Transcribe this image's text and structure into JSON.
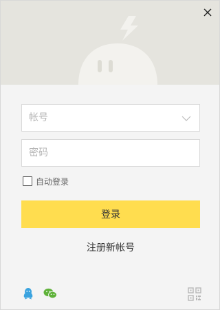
{
  "window": {
    "close_icon": "close-icon"
  },
  "login_form": {
    "account_placeholder": "帐号",
    "password_placeholder": "密码",
    "auto_login_label": "自动登录",
    "login_button_label": "登录",
    "register_link_label": "注册新帐号"
  },
  "footer": {
    "social_icons": [
      "qq-icon",
      "wechat-icon"
    ],
    "qr_icon": "qr-code-icon"
  },
  "colors": {
    "hero_bg": "#e5e4de",
    "body_bg": "#f4f4f4",
    "accent": "#ffdd4f",
    "qq": "#3aa3df",
    "wechat": "#5fb23a"
  }
}
